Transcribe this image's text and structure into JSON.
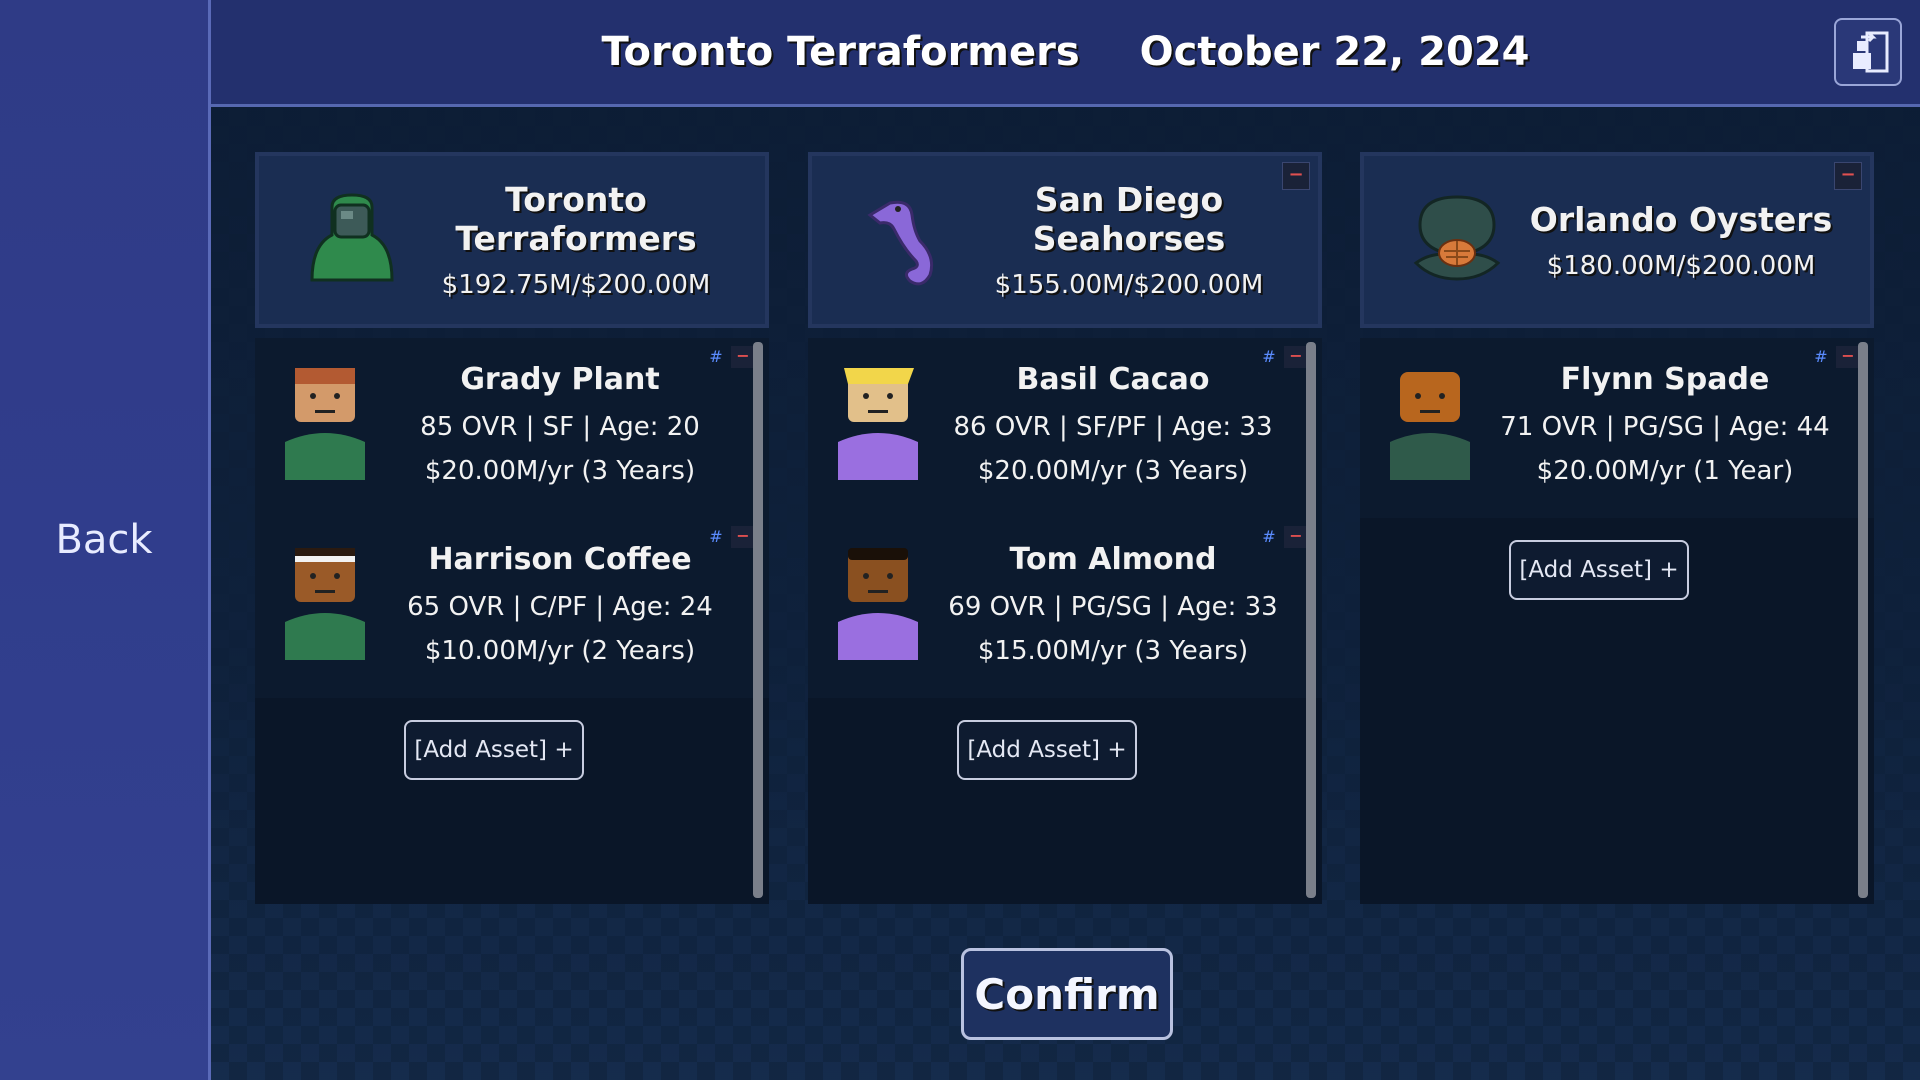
{
  "header": {
    "team": "Toronto Terraformers",
    "date": "October 22, 2024"
  },
  "sidebar": {
    "back_label": "Back"
  },
  "teams": [
    {
      "name": "Toronto Terraformers",
      "cap": "$192.75M/$200.00M",
      "logo": "hazmat-hood-icon",
      "players": [
        {
          "name": "Grady Plant",
          "stats": "85 OVR  |  SF  |  Age: 20",
          "contract": "$20.00M/yr (3 Years)"
        },
        {
          "name": "Harrison Coffee",
          "stats": "65 OVR  |  C/PF  |  Age: 24",
          "contract": "$10.00M/yr (2 Years)"
        }
      ],
      "add_label": "[Add Asset]  +"
    },
    {
      "name": "San Diego Seahorses",
      "cap": "$155.00M/$200.00M",
      "logo": "seahorse-icon",
      "players": [
        {
          "name": "Basil Cacao",
          "stats": "86 OVR  |  SF/PF  |  Age: 33",
          "contract": "$20.00M/yr (3 Years)"
        },
        {
          "name": "Tom Almond",
          "stats": "69 OVR  |  PG/SG  |  Age: 33",
          "contract": "$15.00M/yr (3 Years)"
        }
      ],
      "add_label": "[Add Asset]  +"
    },
    {
      "name": "Orlando Oysters",
      "cap": "$180.00M/$200.00M",
      "logo": "oyster-icon",
      "players": [
        {
          "name": "Flynn Spade",
          "stats": "71 OVR  |  PG/SG  |  Age: 44",
          "contract": "$20.00M/yr (1 Year)"
        }
      ],
      "add_label": "[Add Asset]  +"
    }
  ],
  "controls": {
    "hash": "#",
    "minus": "−"
  },
  "confirm_label": "Confirm",
  "colors": {
    "green_jersey": "#2f7a4f",
    "purple_jersey": "#9a6fe0",
    "accent": "#5b8cff",
    "remove": "#e05050"
  }
}
